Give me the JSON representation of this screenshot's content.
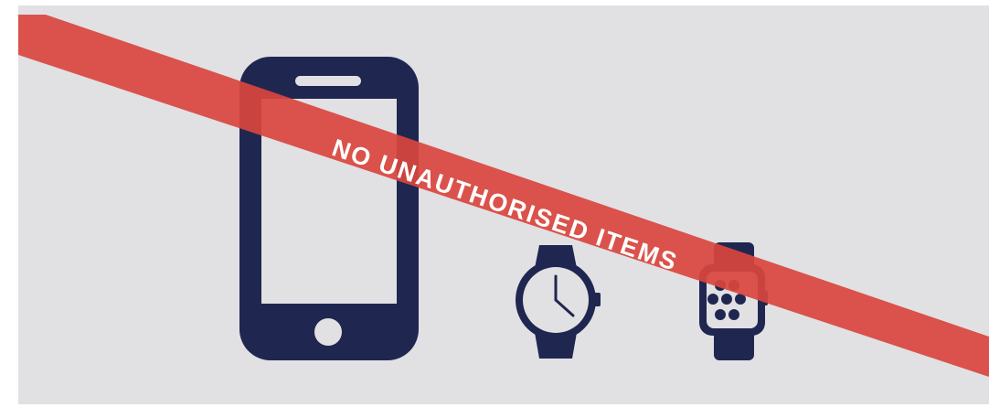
{
  "banner": {
    "text": "NO UNAUTHORISED ITEMS",
    "color": "#d9453e"
  },
  "icons": [
    {
      "name": "smartphone-icon"
    },
    {
      "name": "wristwatch-icon"
    },
    {
      "name": "smartwatch-icon"
    }
  ],
  "colors": {
    "background": "#e1e1e4",
    "icon": "#1f2750",
    "banner": "#d9453e",
    "banner_text": "#ffffff"
  }
}
